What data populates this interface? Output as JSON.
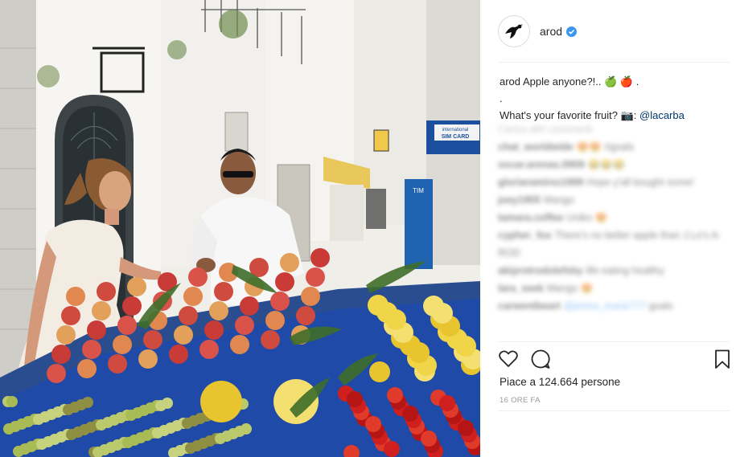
{
  "post": {
    "username": "arod",
    "verified_icon": "verified-badge-icon",
    "caption": {
      "user": "arod",
      "line1": "Apple anyone?!.. 🍏 🍎 .",
      "line2": ".",
      "line3": "What's your favorite fruit? 📷: ",
      "mention": "@lacarba"
    },
    "load_more": "Carica altri commenti",
    "comments": [
      {
        "user": "chat_worldwide",
        "text": "😍😍 #goals"
      },
      {
        "user": "oscar.arenas.0909",
        "text": "😂😂😂"
      },
      {
        "user": "gloriaramirez1999",
        "text": "Hope y'all bought some!"
      },
      {
        "user": "joey1955",
        "text": "Mango"
      },
      {
        "user": "tamara.coffee",
        "text": "Uniko 😍"
      },
      {
        "user": "cypher_fox",
        "text": "There's no better apple than J.Lo's A-ROD"
      },
      {
        "user": "akiprotrodolefsby",
        "text": "life eating healthy"
      },
      {
        "user": "lara_seek",
        "text": "Mango 😍"
      },
      {
        "user": "carwentbeart",
        "text": "",
        "tag": "@jenna_marie777",
        "after": " goals"
      }
    ],
    "likes_text": "Piace a 124.664 persone",
    "timestamp": "16 ORE FA"
  },
  "photo": {
    "sign_top": "international",
    "sign_bottom": "SIM CARD",
    "tim_sign": "TIM"
  },
  "icons": {
    "like": "heart-icon",
    "comment": "comment-icon",
    "save": "bookmark-icon"
  },
  "colors": {
    "link": "#003569",
    "verified": "#3897f0",
    "muted": "#999999"
  }
}
